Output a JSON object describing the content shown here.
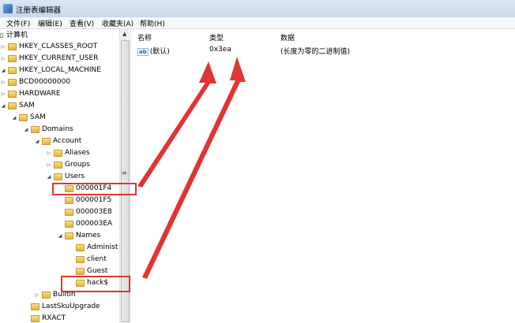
{
  "window": {
    "title": "注册表编辑器"
  },
  "menu": [
    "文件(F)",
    "编辑(E)",
    "查看(V)",
    "收藏夹(A)",
    "帮助(H)"
  ],
  "tree": {
    "root_label": "计算机",
    "nodes": [
      "HKEY_CLASSES_ROOT",
      "HKEY_CURRENT_USER",
      "HKEY_LOCAL_MACHINE",
      "BCD00000000",
      "HARDWARE",
      "SAM",
      "SAM",
      "Domains",
      "Account",
      "Aliases",
      "Groups",
      "Users",
      "000001F4",
      "000001F5",
      "000003E8",
      "000003EA",
      "Names",
      "Administ",
      "client",
      "Guest",
      "hack$",
      "Builtin",
      "LastSkuUpgrade",
      "RXACT"
    ]
  },
  "list": {
    "columns": [
      "名称",
      "类型",
      "数据"
    ],
    "rows": [
      {
        "name": "(默认)",
        "type": "0x3ea",
        "data": "(长度为零的二进制值)"
      }
    ]
  },
  "icons": {
    "value": "ab-value-icon",
    "folder": "folder-icon",
    "app": "regedit-icon"
  },
  "colors": {
    "annotation": "#e03535",
    "folder": "#e8c04f",
    "title_bar": "#c7d7ec"
  }
}
